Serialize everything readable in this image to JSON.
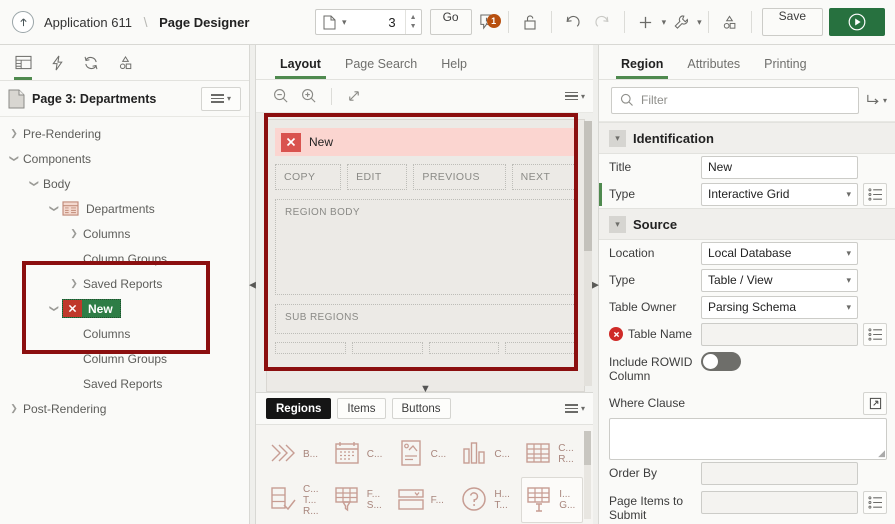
{
  "topbar": {
    "up_icon": "arrow-up-icon",
    "breadcrumb_app": "Application 611",
    "breadcrumb_sep": "\\",
    "breadcrumb_current": "Page Designer",
    "page_number_value": "3",
    "page_icon": "page-icon",
    "go_label": "Go",
    "error_count": "1",
    "error_icon": "error-flag-icon",
    "lock_icon": "unlock-icon",
    "undo_icon": "undo-icon",
    "redo_icon": "redo-icon",
    "add_icon": "plus-icon",
    "utilities_icon": "wrench-icon",
    "shared_icon": "shapes-icon",
    "save_label": "Save",
    "run_icon": "play-icon"
  },
  "left_panel": {
    "tabs": [
      {
        "name": "rendering-tab",
        "icon": "layout-icon",
        "active": true
      },
      {
        "name": "dynamic-actions-tab",
        "icon": "lightning-icon",
        "active": false
      },
      {
        "name": "processing-tab",
        "icon": "refresh-icon",
        "active": false
      },
      {
        "name": "shared-components-tab",
        "icon": "shapes-icon",
        "active": false
      }
    ],
    "page_title": "Page 3: Departments",
    "menu_icon": "hamburger-menu-icon",
    "tree": [
      {
        "label": "Pre-Rendering",
        "indent": 0,
        "twisty": "collapsed",
        "icon": null,
        "selected": false
      },
      {
        "label": "Components",
        "indent": 0,
        "twisty": "expanded",
        "icon": null,
        "selected": false
      },
      {
        "label": "Body",
        "indent": 1,
        "twisty": "expanded",
        "icon": null,
        "selected": false
      },
      {
        "label": "Departments",
        "indent": 2,
        "twisty": "expanded",
        "icon": "interactive-grid-icon",
        "selected": false
      },
      {
        "label": "Columns",
        "indent": 3,
        "twisty": "collapsed",
        "icon": null,
        "selected": false
      },
      {
        "label": "Column Groups",
        "indent": 3,
        "twisty": "none",
        "icon": null,
        "selected": false
      },
      {
        "label": "Saved Reports",
        "indent": 3,
        "twisty": "collapsed",
        "icon": null,
        "selected": false
      },
      {
        "label": "New",
        "indent": 2,
        "twisty": "expanded",
        "icon": "error-x-icon",
        "selected": true
      },
      {
        "label": "Columns",
        "indent": 3,
        "twisty": "none",
        "icon": null,
        "selected": false
      },
      {
        "label": "Column Groups",
        "indent": 3,
        "twisty": "none",
        "icon": null,
        "selected": false
      },
      {
        "label": "Saved Reports",
        "indent": 3,
        "twisty": "none",
        "icon": null,
        "selected": false
      },
      {
        "label": "Post-Rendering",
        "indent": 0,
        "twisty": "collapsed",
        "icon": null,
        "selected": false
      }
    ]
  },
  "center_panel": {
    "tabs": [
      {
        "label": "Layout",
        "active": true
      },
      {
        "label": "Page Search",
        "active": false
      },
      {
        "label": "Help",
        "active": false
      }
    ],
    "toolbar": {
      "zoom_out_icon": "zoom-out-icon",
      "zoom_in_icon": "zoom-in-icon",
      "expand_icon": "expand-diagonal-icon",
      "menu_icon": "hamburger-menu-icon"
    },
    "region": {
      "error_icon": "error-x-icon",
      "title": "New",
      "buttons": [
        "COPY",
        "EDIT",
        "PREVIOUS",
        "NEXT"
      ],
      "body_label": "REGION BODY",
      "sub_regions_label": "SUB REGIONS"
    },
    "gallery_tabs": [
      {
        "label": "Regions",
        "active": true
      },
      {
        "label": "Items",
        "active": false
      },
      {
        "label": "Buttons",
        "active": false
      }
    ],
    "gallery_menu_icon": "hamburger-menu-icon",
    "gallery_items": [
      {
        "icon": "chevrons-icon",
        "label": "B...",
        "boxed": false
      },
      {
        "icon": "calendar-icon",
        "label": "C...",
        "boxed": false
      },
      {
        "icon": "card-icon",
        "label": "C...",
        "boxed": false
      },
      {
        "icon": "chart-icon",
        "label": "C...",
        "boxed": false
      },
      {
        "icon": "grid-icon",
        "label": "C...\nR...",
        "boxed": false
      },
      {
        "icon": "checklist-icon",
        "label": "C...\nT...\nR...",
        "boxed": false
      },
      {
        "icon": "filter-grid-icon",
        "label": "F...\nS...",
        "boxed": false
      },
      {
        "icon": "form-icon",
        "label": "F...",
        "boxed": false
      },
      {
        "icon": "help-icon",
        "label": "H...\nT...",
        "boxed": false
      },
      {
        "icon": "interactive-grid-icon",
        "label": "I...\nG...",
        "boxed": true
      }
    ]
  },
  "right_panel": {
    "tabs": [
      {
        "label": "Region",
        "active": true
      },
      {
        "label": "Attributes",
        "active": false
      },
      {
        "label": "Printing",
        "active": false
      }
    ],
    "filter": {
      "icon": "search-icon",
      "placeholder": "Filter",
      "goto_icon": "goto-error-icon"
    },
    "sections": [
      {
        "title": "Identification",
        "chevron_icon": "chevron-down-icon",
        "rows": [
          {
            "label": "Title",
            "type": "input",
            "value": "New",
            "active": false,
            "error": false,
            "lov": false
          },
          {
            "label": "Type",
            "type": "select",
            "value": "Interactive Grid",
            "active": true,
            "error": false,
            "lov": true
          }
        ]
      },
      {
        "title": "Source",
        "chevron_icon": "chevron-down-icon",
        "rows": [
          {
            "label": "Location",
            "type": "select",
            "value": "Local Database",
            "active": false,
            "error": false,
            "lov": false
          },
          {
            "label": "Type",
            "type": "select",
            "value": "Table / View",
            "active": false,
            "error": false,
            "lov": false
          },
          {
            "label": "Table Owner",
            "type": "select",
            "value": "Parsing Schema",
            "active": false,
            "error": false,
            "lov": false
          },
          {
            "label": "Table Name",
            "type": "input",
            "value": "",
            "active": false,
            "error": true,
            "lov": true
          },
          {
            "label": "Include ROWID Column",
            "type": "toggle",
            "value": "off",
            "active": false,
            "error": false,
            "lov": false
          },
          {
            "label": "Where Clause",
            "type": "textarea",
            "value": "",
            "active": false,
            "error": false,
            "lov": false,
            "expand_icon": "expand-editor-icon"
          },
          {
            "label": "Order By",
            "type": "input",
            "value": "",
            "active": false,
            "error": false,
            "lov": false
          },
          {
            "label": "Page Items to Submit",
            "type": "input",
            "value": "",
            "active": false,
            "error": false,
            "lov": true
          }
        ]
      }
    ]
  },
  "annotations": {
    "tree_highlight": "red-box-around-new-node",
    "canvas_highlight": "red-box-around-new-region"
  },
  "colors": {
    "accent_green": "#27713f",
    "selected_green": "#2e7d46",
    "error_red": "#c0392b",
    "annotation_red": "#8b0f0f",
    "region_header_pink": "#fbd5d0",
    "gallery_icon": "#c79d93"
  }
}
